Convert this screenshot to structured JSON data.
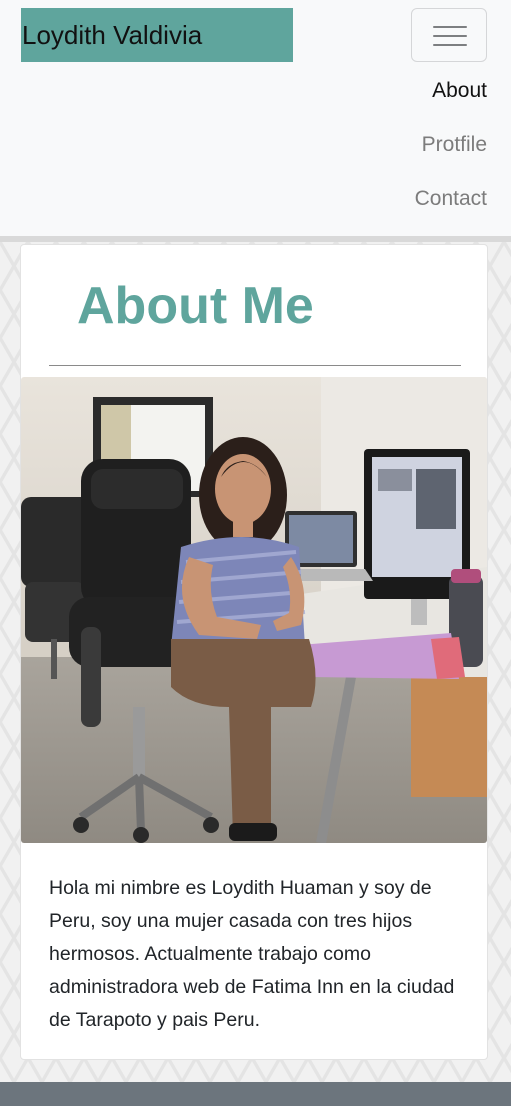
{
  "navbar": {
    "brand": "Loydith Valdivia",
    "brand_color": "#5fa59d",
    "links": [
      {
        "label": "About",
        "active": true
      },
      {
        "label": "Protfile",
        "active": false
      },
      {
        "label": "Contact",
        "active": false
      }
    ]
  },
  "about": {
    "title": "About Me",
    "title_color": "#5fa59d",
    "bio": "Hola mi nimbre es Loydith Huaman y soy de Peru, soy una mujer casada con tres hijos hermosos. Actualmente trabajo como administradora web de Fatima Inn en la ciudad de Tarapoto y pais Peru."
  },
  "icons": {
    "toggler": "hamburger-menu-icon"
  }
}
